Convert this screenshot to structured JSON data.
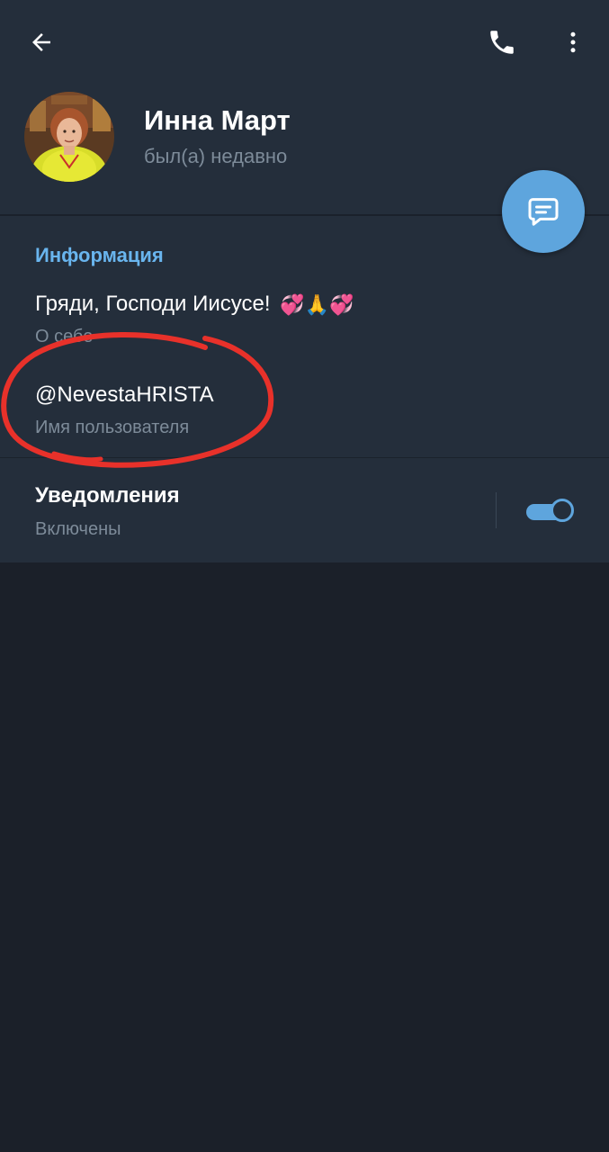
{
  "header": {
    "back_icon": "arrow-left-icon",
    "call_icon": "phone-icon",
    "menu_icon": "more-vertical-icon"
  },
  "profile": {
    "name": "Инна Март",
    "status": "был(а) недавно",
    "avatar": "profile-photo"
  },
  "fab": {
    "icon": "message-icon"
  },
  "info": {
    "section_title": "Информация",
    "bio": {
      "text": "Гряди, Господи Иисусе!",
      "emojis": "💞🙏💞",
      "label": "О себе"
    },
    "username": {
      "value": "@NevestaHRISTA",
      "label": "Имя пользователя"
    }
  },
  "notifications": {
    "title": "Уведомления",
    "status": "Включены",
    "enabled": true
  },
  "colors": {
    "background": "#1b2029",
    "panel": "#242e3b",
    "accent": "#5ea5dd",
    "section_title": "#69b5ee",
    "secondary_text": "#7d8b99",
    "annotation": "#e8312a"
  }
}
